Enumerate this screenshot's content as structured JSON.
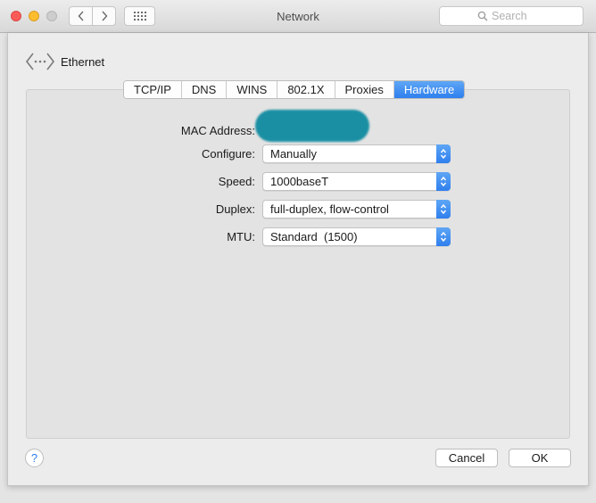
{
  "window": {
    "title": "Network",
    "search_placeholder": "Search"
  },
  "sheet": {
    "interface_label": "Ethernet",
    "tabs": [
      {
        "label": "TCP/IP",
        "active": false
      },
      {
        "label": "DNS",
        "active": false
      },
      {
        "label": "WINS",
        "active": false
      },
      {
        "label": "802.1X",
        "active": false
      },
      {
        "label": "Proxies",
        "active": false
      },
      {
        "label": "Hardware",
        "active": true
      }
    ],
    "mac_address_label": "MAC Address:",
    "configure": {
      "label": "Configure:",
      "value": "Manually"
    },
    "speed": {
      "label": "Speed:",
      "value": "1000baseT"
    },
    "duplex": {
      "label": "Duplex:",
      "value": "full-duplex, flow-control"
    },
    "mtu": {
      "label": "MTU:",
      "value": "Standard  (1500)"
    },
    "help_label": "?",
    "cancel_label": "Cancel",
    "ok_label": "OK"
  },
  "colors": {
    "accent": "#2f7fee",
    "redaction": "#1a8fa3"
  }
}
